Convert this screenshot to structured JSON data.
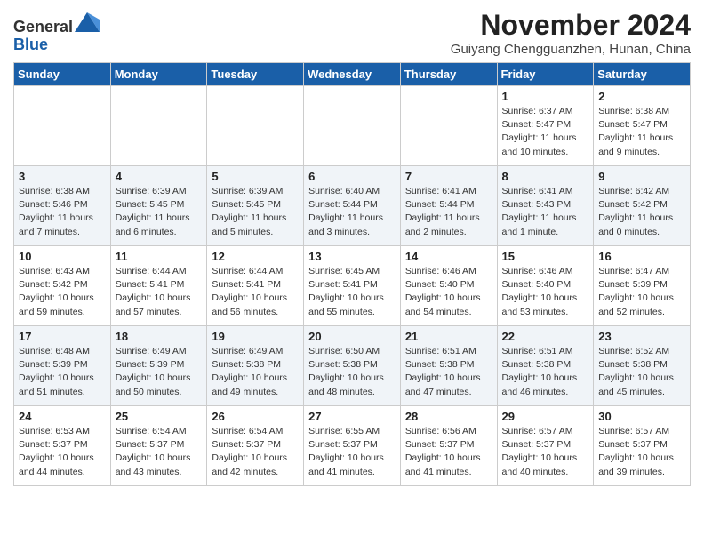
{
  "header": {
    "logo_general": "General",
    "logo_blue": "Blue",
    "month_title": "November 2024",
    "location": "Guiyang Chengguanzhen, Hunan, China"
  },
  "weekdays": [
    "Sunday",
    "Monday",
    "Tuesday",
    "Wednesday",
    "Thursday",
    "Friday",
    "Saturday"
  ],
  "weeks": [
    [
      {
        "day": "",
        "info": ""
      },
      {
        "day": "",
        "info": ""
      },
      {
        "day": "",
        "info": ""
      },
      {
        "day": "",
        "info": ""
      },
      {
        "day": "",
        "info": ""
      },
      {
        "day": "1",
        "info": "Sunrise: 6:37 AM\nSunset: 5:47 PM\nDaylight: 11 hours\nand 10 minutes."
      },
      {
        "day": "2",
        "info": "Sunrise: 6:38 AM\nSunset: 5:47 PM\nDaylight: 11 hours\nand 9 minutes."
      }
    ],
    [
      {
        "day": "3",
        "info": "Sunrise: 6:38 AM\nSunset: 5:46 PM\nDaylight: 11 hours\nand 7 minutes."
      },
      {
        "day": "4",
        "info": "Sunrise: 6:39 AM\nSunset: 5:45 PM\nDaylight: 11 hours\nand 6 minutes."
      },
      {
        "day": "5",
        "info": "Sunrise: 6:39 AM\nSunset: 5:45 PM\nDaylight: 11 hours\nand 5 minutes."
      },
      {
        "day": "6",
        "info": "Sunrise: 6:40 AM\nSunset: 5:44 PM\nDaylight: 11 hours\nand 3 minutes."
      },
      {
        "day": "7",
        "info": "Sunrise: 6:41 AM\nSunset: 5:44 PM\nDaylight: 11 hours\nand 2 minutes."
      },
      {
        "day": "8",
        "info": "Sunrise: 6:41 AM\nSunset: 5:43 PM\nDaylight: 11 hours\nand 1 minute."
      },
      {
        "day": "9",
        "info": "Sunrise: 6:42 AM\nSunset: 5:42 PM\nDaylight: 11 hours\nand 0 minutes."
      }
    ],
    [
      {
        "day": "10",
        "info": "Sunrise: 6:43 AM\nSunset: 5:42 PM\nDaylight: 10 hours\nand 59 minutes."
      },
      {
        "day": "11",
        "info": "Sunrise: 6:44 AM\nSunset: 5:41 PM\nDaylight: 10 hours\nand 57 minutes."
      },
      {
        "day": "12",
        "info": "Sunrise: 6:44 AM\nSunset: 5:41 PM\nDaylight: 10 hours\nand 56 minutes."
      },
      {
        "day": "13",
        "info": "Sunrise: 6:45 AM\nSunset: 5:41 PM\nDaylight: 10 hours\nand 55 minutes."
      },
      {
        "day": "14",
        "info": "Sunrise: 6:46 AM\nSunset: 5:40 PM\nDaylight: 10 hours\nand 54 minutes."
      },
      {
        "day": "15",
        "info": "Sunrise: 6:46 AM\nSunset: 5:40 PM\nDaylight: 10 hours\nand 53 minutes."
      },
      {
        "day": "16",
        "info": "Sunrise: 6:47 AM\nSunset: 5:39 PM\nDaylight: 10 hours\nand 52 minutes."
      }
    ],
    [
      {
        "day": "17",
        "info": "Sunrise: 6:48 AM\nSunset: 5:39 PM\nDaylight: 10 hours\nand 51 minutes."
      },
      {
        "day": "18",
        "info": "Sunrise: 6:49 AM\nSunset: 5:39 PM\nDaylight: 10 hours\nand 50 minutes."
      },
      {
        "day": "19",
        "info": "Sunrise: 6:49 AM\nSunset: 5:38 PM\nDaylight: 10 hours\nand 49 minutes."
      },
      {
        "day": "20",
        "info": "Sunrise: 6:50 AM\nSunset: 5:38 PM\nDaylight: 10 hours\nand 48 minutes."
      },
      {
        "day": "21",
        "info": "Sunrise: 6:51 AM\nSunset: 5:38 PM\nDaylight: 10 hours\nand 47 minutes."
      },
      {
        "day": "22",
        "info": "Sunrise: 6:51 AM\nSunset: 5:38 PM\nDaylight: 10 hours\nand 46 minutes."
      },
      {
        "day": "23",
        "info": "Sunrise: 6:52 AM\nSunset: 5:38 PM\nDaylight: 10 hours\nand 45 minutes."
      }
    ],
    [
      {
        "day": "24",
        "info": "Sunrise: 6:53 AM\nSunset: 5:37 PM\nDaylight: 10 hours\nand 44 minutes."
      },
      {
        "day": "25",
        "info": "Sunrise: 6:54 AM\nSunset: 5:37 PM\nDaylight: 10 hours\nand 43 minutes."
      },
      {
        "day": "26",
        "info": "Sunrise: 6:54 AM\nSunset: 5:37 PM\nDaylight: 10 hours\nand 42 minutes."
      },
      {
        "day": "27",
        "info": "Sunrise: 6:55 AM\nSunset: 5:37 PM\nDaylight: 10 hours\nand 41 minutes."
      },
      {
        "day": "28",
        "info": "Sunrise: 6:56 AM\nSunset: 5:37 PM\nDaylight: 10 hours\nand 41 minutes."
      },
      {
        "day": "29",
        "info": "Sunrise: 6:57 AM\nSunset: 5:37 PM\nDaylight: 10 hours\nand 40 minutes."
      },
      {
        "day": "30",
        "info": "Sunrise: 6:57 AM\nSunset: 5:37 PM\nDaylight: 10 hours\nand 39 minutes."
      }
    ]
  ]
}
